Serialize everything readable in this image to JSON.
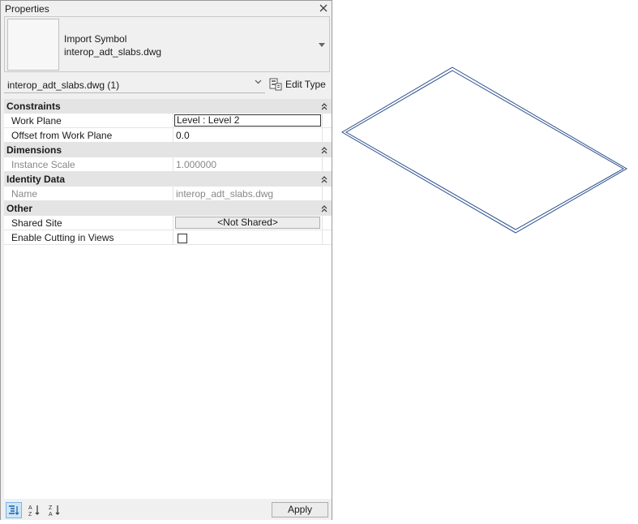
{
  "panel": {
    "title": "Properties",
    "close_icon": "close-icon"
  },
  "type_selector": {
    "family": "Import Symbol",
    "type_name": "interop_adt_slabs.dwg"
  },
  "instance_selector": {
    "label": "interop_adt_slabs.dwg (1)",
    "edit_type_label": "Edit Type"
  },
  "categories": {
    "constraints": {
      "label": "Constraints",
      "work_plane": {
        "name": "Work Plane",
        "value": "Level : Level 2"
      },
      "offset": {
        "name": "Offset from Work Plane",
        "value": "0.0"
      }
    },
    "dimensions": {
      "label": "Dimensions",
      "instance_scale": {
        "name": "Instance Scale",
        "value": "1.000000"
      }
    },
    "identity": {
      "label": "Identity Data",
      "name_prop": {
        "name": "Name",
        "value": "interop_adt_slabs.dwg"
      }
    },
    "other": {
      "label": "Other",
      "shared_site": {
        "name": "Shared Site",
        "value": "<Not Shared>"
      },
      "enable_cutting": {
        "name": "Enable Cutting in Views",
        "checked": false
      }
    }
  },
  "bottom": {
    "apply_label": "Apply"
  },
  "colors": {
    "slab_outline": "#2a4e8c",
    "category_bg": "#e4e4e4",
    "active_sort": "#cde6f7"
  }
}
